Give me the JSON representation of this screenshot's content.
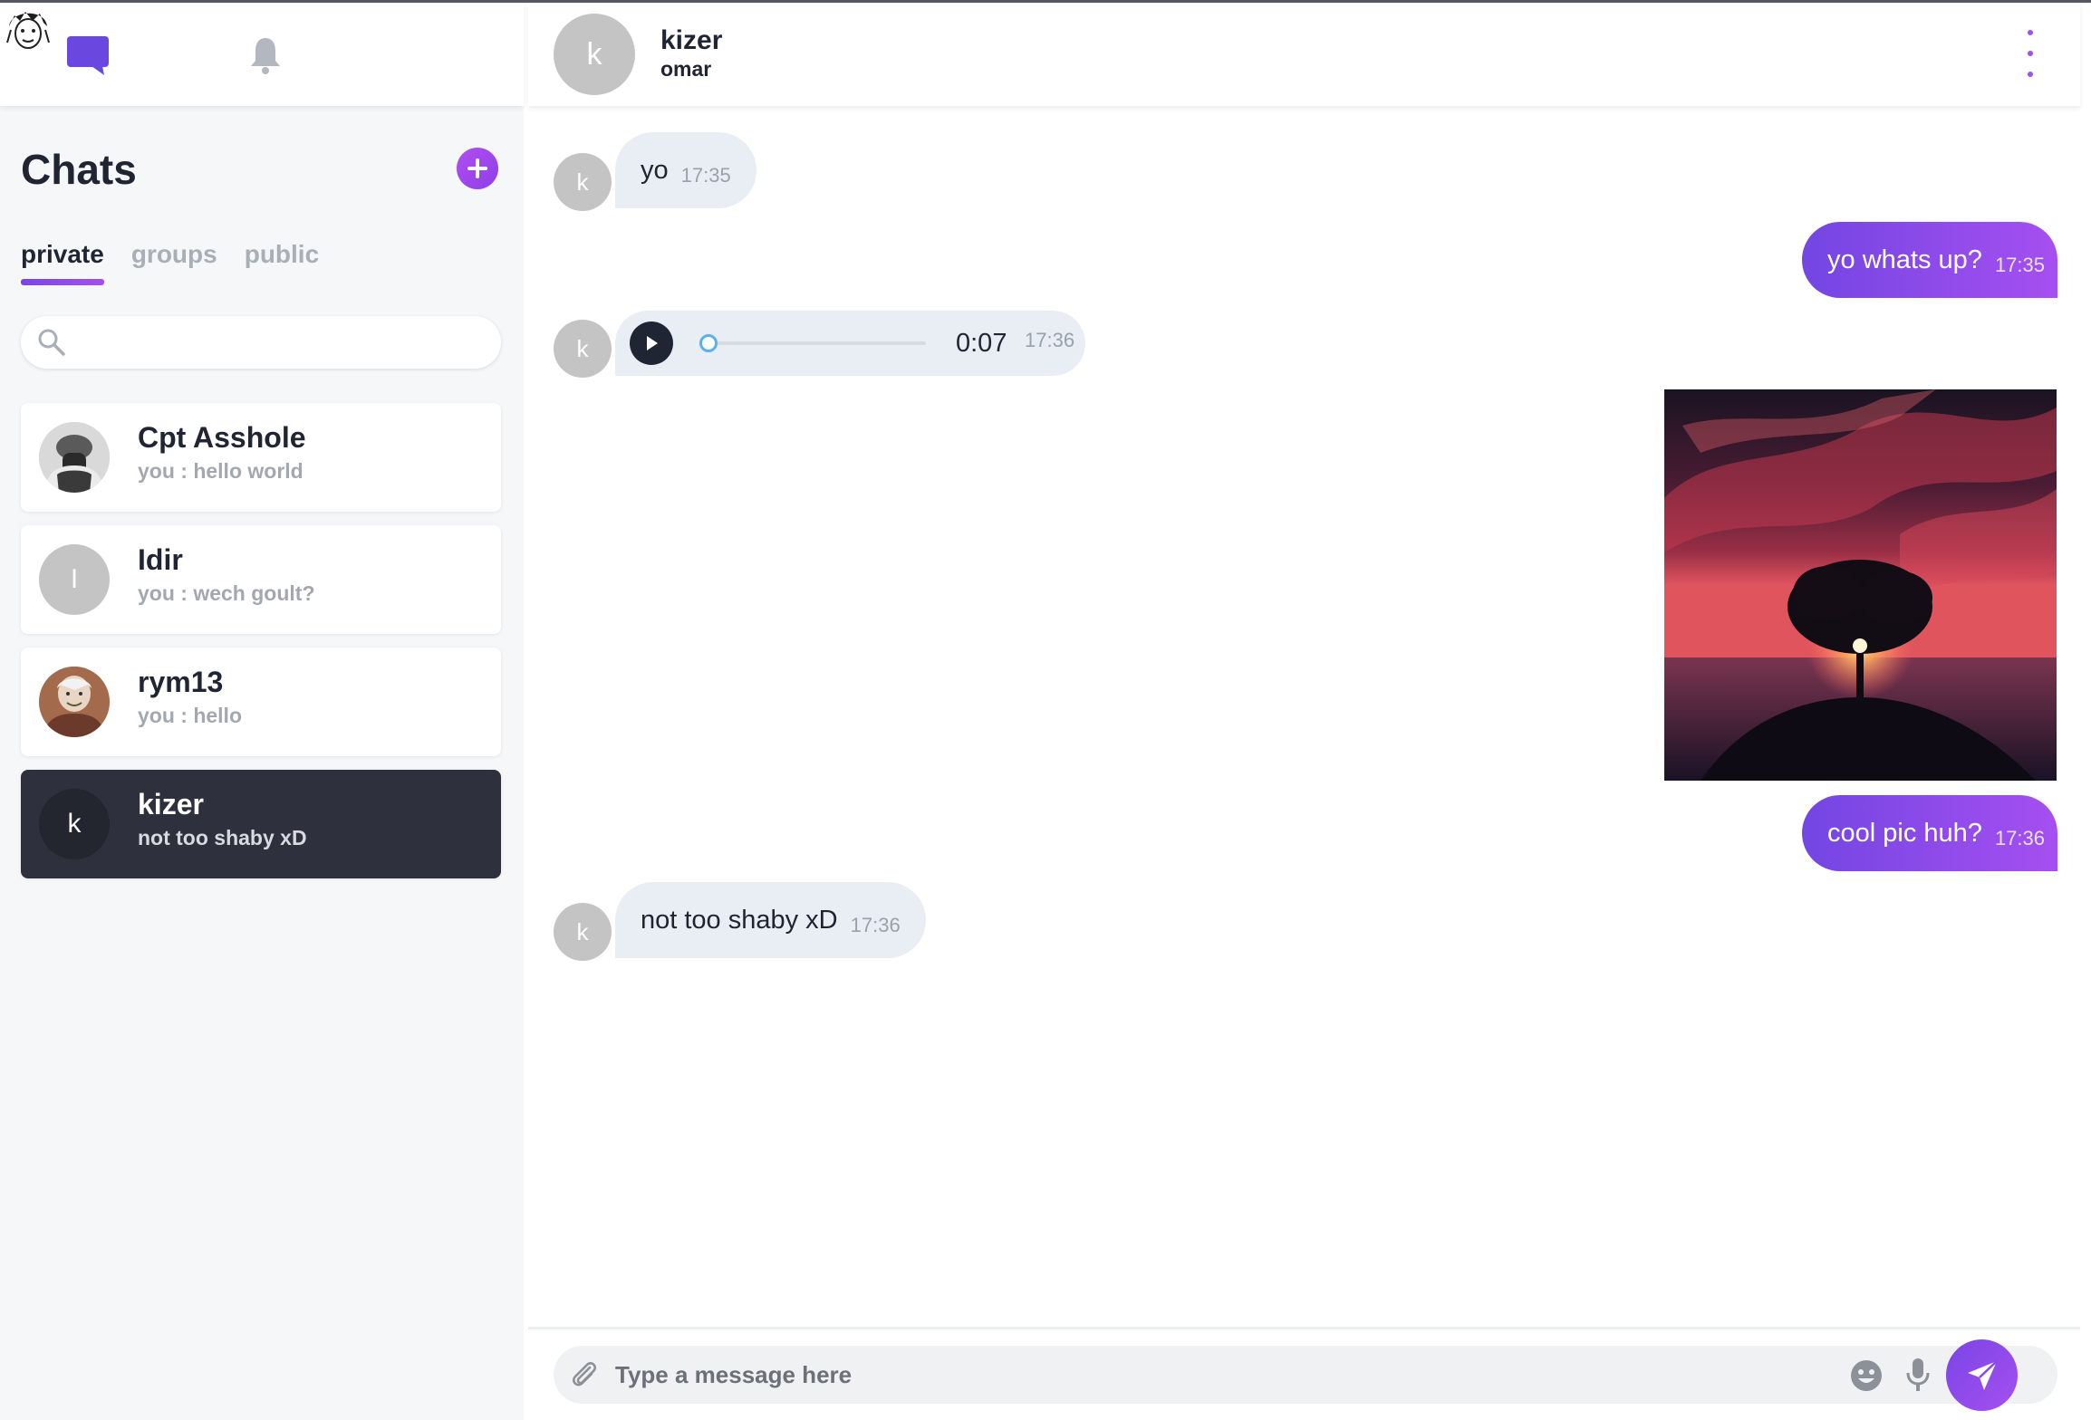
{
  "sidebar": {
    "title": "Chats",
    "tabs": [
      {
        "label": "private",
        "active": true
      },
      {
        "label": "groups",
        "active": false
      },
      {
        "label": "public",
        "active": false
      }
    ],
    "search": {
      "value": "",
      "placeholder": ""
    },
    "conversations": [
      {
        "name": "Cpt Asshole",
        "last_message": "you : hello world",
        "avatar": "photo-avatar",
        "selected": false
      },
      {
        "name": "Idir",
        "last_message": "you : wech goult?",
        "avatar_letter": "I",
        "selected": false
      },
      {
        "name": "rym13",
        "last_message": "you : hello",
        "avatar": "photo-avatar",
        "selected": false
      },
      {
        "name": "kizer",
        "last_message": "not too shaby xD",
        "avatar_letter": "k",
        "selected": true
      }
    ]
  },
  "header": {
    "avatar_letter": "k",
    "name": "kizer",
    "subtitle": "omar"
  },
  "messages": [
    {
      "direction": "in",
      "avatar_letter": "k",
      "type": "text",
      "text": "yo",
      "time": "17:35"
    },
    {
      "direction": "out",
      "type": "text",
      "text": "yo whats up?",
      "time": "17:35"
    },
    {
      "direction": "in",
      "avatar_letter": "k",
      "type": "audio",
      "duration": "0:07",
      "time": "17:36",
      "progress": 0
    },
    {
      "direction": "out",
      "type": "image",
      "image": "sunset-tree-photo"
    },
    {
      "direction": "out",
      "type": "text",
      "text": "cool pic huh?",
      "time": "17:36"
    },
    {
      "direction": "in",
      "avatar_letter": "k",
      "type": "text",
      "text": "not too shaby xD",
      "time": "17:36"
    }
  ],
  "composer": {
    "placeholder": "Type a message here",
    "value": ""
  },
  "icons": {
    "nav": [
      "chat-icon",
      "bell-icon",
      "user-avatar"
    ],
    "composer": [
      "paperclip-icon",
      "emoji-icon",
      "microphone-icon",
      "send-icon"
    ]
  },
  "colors": {
    "accent": "#8e3fe8",
    "accent_light": "#a64ff0",
    "selected_row": "#2e303e",
    "incoming_bubble": "#e9eef5",
    "sidebar_bg": "#f6f7f9"
  }
}
